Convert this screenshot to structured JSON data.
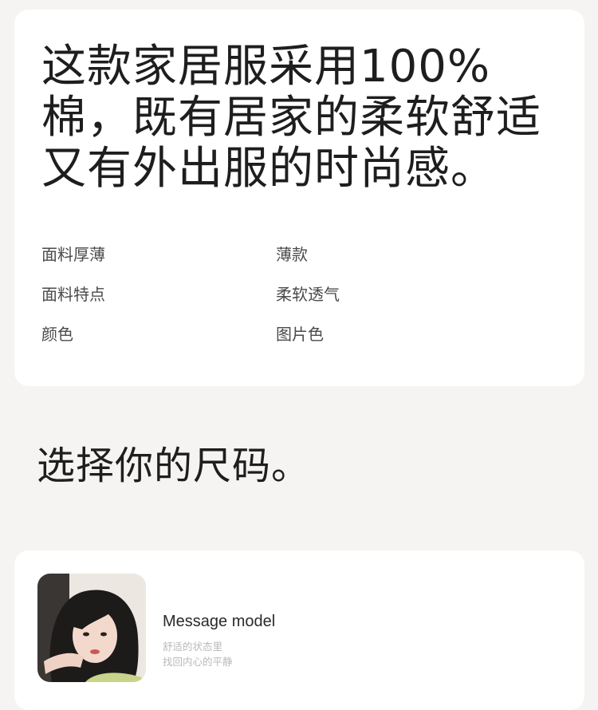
{
  "product": {
    "headline": "这款家居服采用100%棉，既有居家的柔软舒适又有外出服的时尚感。",
    "specs": [
      {
        "label": "面料厚薄",
        "value": "薄款"
      },
      {
        "label": "面料特点",
        "value": "柔软透气"
      },
      {
        "label": "颜色",
        "value": "图片色"
      }
    ]
  },
  "size_section": {
    "title": "选择你的尺码。"
  },
  "model_card": {
    "name": "Message model",
    "line1": "舒适的状态里",
    "line2": "找回内心的平静"
  }
}
